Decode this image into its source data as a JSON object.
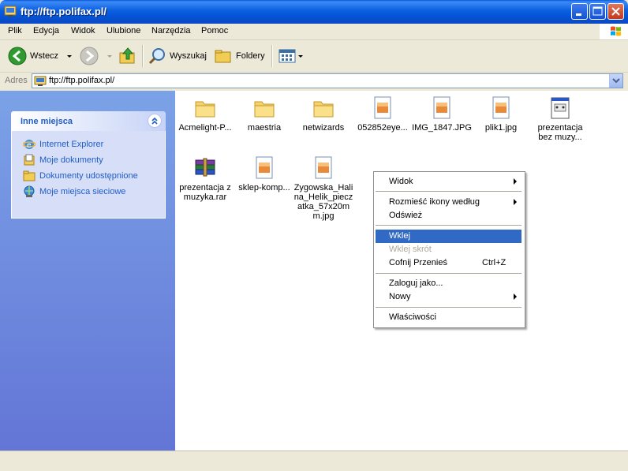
{
  "window": {
    "title": "ftp://ftp.polifax.pl/"
  },
  "menu": [
    "Plik",
    "Edycja",
    "Widok",
    "Ulubione",
    "Narzędzia",
    "Pomoc"
  ],
  "toolbar": {
    "back": "Wstecz",
    "search": "Wyszukaj",
    "folders": "Foldery"
  },
  "address": {
    "label": "Adres",
    "value": "ftp://ftp.polifax.pl/"
  },
  "sidebar": {
    "title": "Inne miejsca",
    "items": [
      {
        "label": "Internet Explorer",
        "icon": "ie-icon"
      },
      {
        "label": "Moje dokumenty",
        "icon": "my-documents-icon"
      },
      {
        "label": "Dokumenty udostępnione",
        "icon": "shared-docs-icon"
      },
      {
        "label": "Moje miejsca sieciowe",
        "icon": "network-places-icon"
      }
    ]
  },
  "files": [
    {
      "name": "Acmelight-P...",
      "type": "folder"
    },
    {
      "name": "maestria",
      "type": "folder"
    },
    {
      "name": "netwizards",
      "type": "folder"
    },
    {
      "name": "052852eye...",
      "type": "image"
    },
    {
      "name": "IMG_1847.JPG",
      "type": "image"
    },
    {
      "name": "plik1.jpg",
      "type": "image"
    },
    {
      "name": "prezentacja bez muzy...",
      "type": "exe"
    },
    {
      "name": "prezentacja z muzyka.rar",
      "type": "rar"
    },
    {
      "name": "sklep-komp...",
      "type": "image"
    },
    {
      "name": "Zygowska_Halina_Helik_pieczatka_57x20mm.jpg",
      "type": "image"
    }
  ],
  "context_menu": {
    "widok": "Widok",
    "rozmiesc": "Rozmieść ikony według",
    "odswiez": "Odśwież",
    "wklej": "Wklej",
    "wklej_skrot": "Wklej skrót",
    "cofnij": "Cofnij Przenieś",
    "cofnij_shortcut": "Ctrl+Z",
    "zaloguj": "Zaloguj jako...",
    "nowy": "Nowy",
    "wlasciwosci": "Właściwości"
  }
}
